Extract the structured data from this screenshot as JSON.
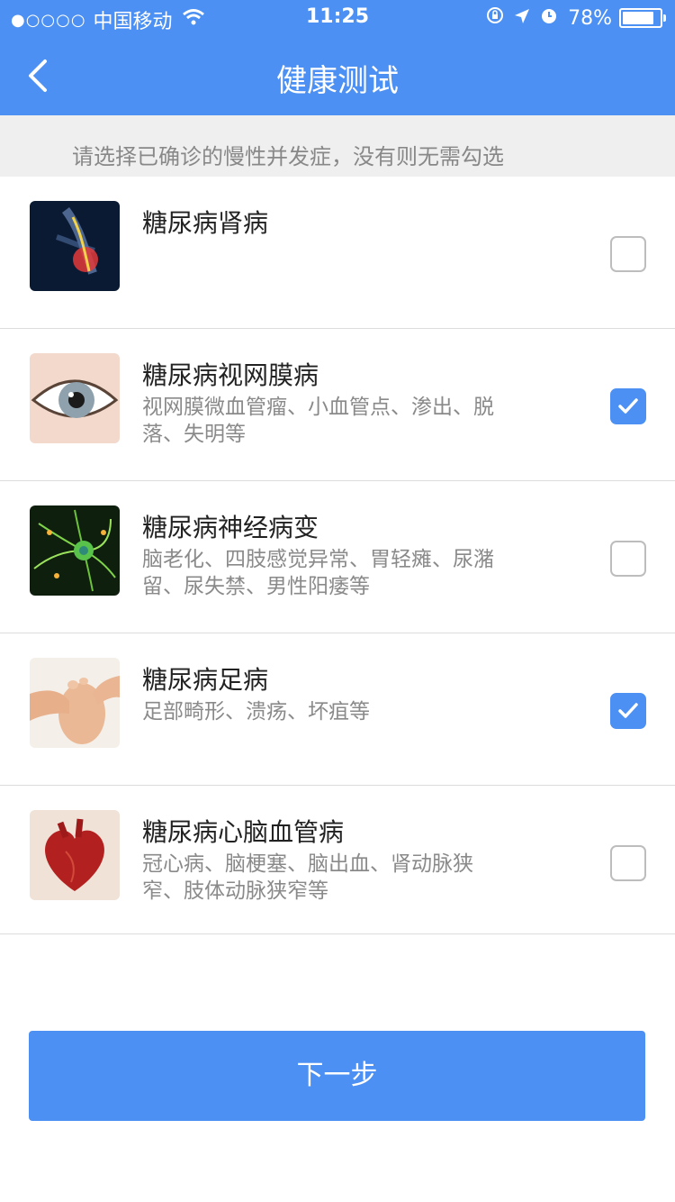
{
  "status_bar": {
    "signal": "●○○○○",
    "carrier": "中国移动",
    "time": "11:25",
    "battery_percent": "78%"
  },
  "header": {
    "title": "健康测试"
  },
  "hint": "请选择已确诊的慢性并发症，没有则无需勾选",
  "items": [
    {
      "name": "糖尿病肾病",
      "desc": "",
      "checked": false
    },
    {
      "name": "糖尿病视网膜病",
      "desc": "视网膜微血管瘤、小血管点、渗出、脱落、失明等",
      "checked": true
    },
    {
      "name": "糖尿病神经病变",
      "desc": "脑老化、四肢感觉异常、胃轻瘫、尿潴留、尿失禁、男性阳痿等",
      "checked": false
    },
    {
      "name": "糖尿病足病",
      "desc": "足部畸形、溃疡、坏疽等",
      "checked": true
    },
    {
      "name": "糖尿病心脑血管病",
      "desc": "冠心病、脑梗塞、脑出血、肾动脉狭窄、肢体动脉狭窄等",
      "checked": false
    }
  ],
  "next_button": "下一步",
  "colors": {
    "primary": "#4b90f2",
    "hint_bg": "#efefef"
  }
}
